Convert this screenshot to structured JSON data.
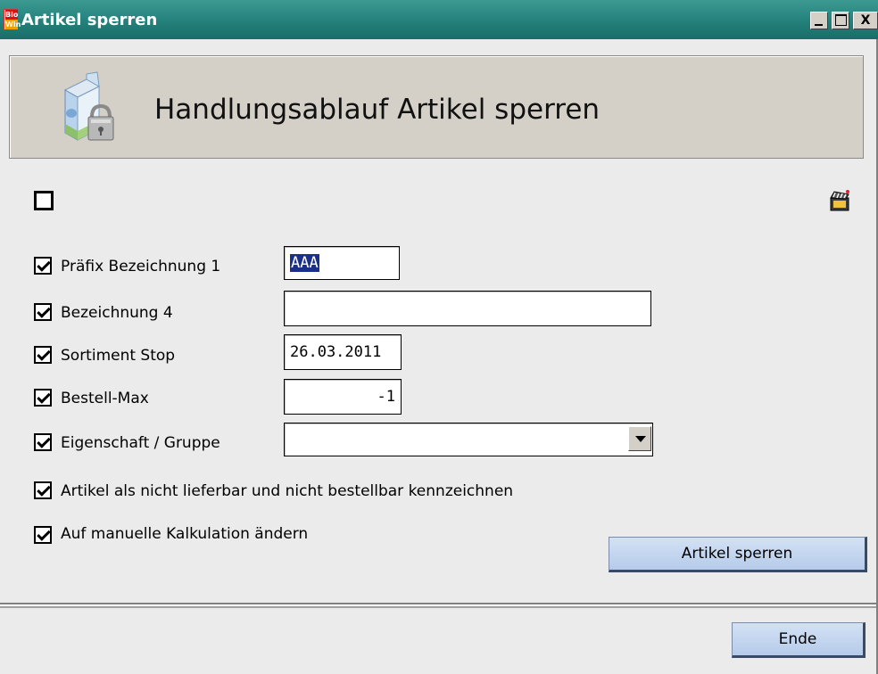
{
  "window": {
    "logo_text_top": "Bio",
    "logo_text_bottom": "Win",
    "title": "Artikel sperren",
    "minimize_icon": "minimize-icon",
    "maximize_icon": "maximize-icon",
    "close_label": "X"
  },
  "header": {
    "title": "Handlungsablauf Artikel sperren",
    "icon": "milk-carton-lock-icon"
  },
  "fields": {
    "prefix": {
      "label": "Präfix Bezeichnung 1",
      "checked": true,
      "value": "AAA"
    },
    "bez4": {
      "label": "Bezeichnung 4",
      "checked": true,
      "value": ""
    },
    "sortiment": {
      "label": "Sortiment Stop",
      "checked": true,
      "value": "26.03.2011"
    },
    "bestellmax": {
      "label": "Bestell-Max",
      "checked": true,
      "value": "-1"
    },
    "eigenschaft": {
      "label": "Eigenschaft / Gruppe",
      "checked": true,
      "value": ""
    },
    "nicht_lieferbar": {
      "label": "Artikel als nicht lieferbar und nicht bestellbar kennzeichnen",
      "checked": true
    },
    "manuelle_kalk": {
      "label": "Auf manuelle Kalkulation ändern",
      "checked": true
    }
  },
  "buttons": {
    "sperren": "Artikel sperren",
    "ende": "Ende"
  },
  "colors": {
    "titlebar": "#24807a",
    "selection": "#1a2f8a",
    "button": "#b5cbea"
  }
}
